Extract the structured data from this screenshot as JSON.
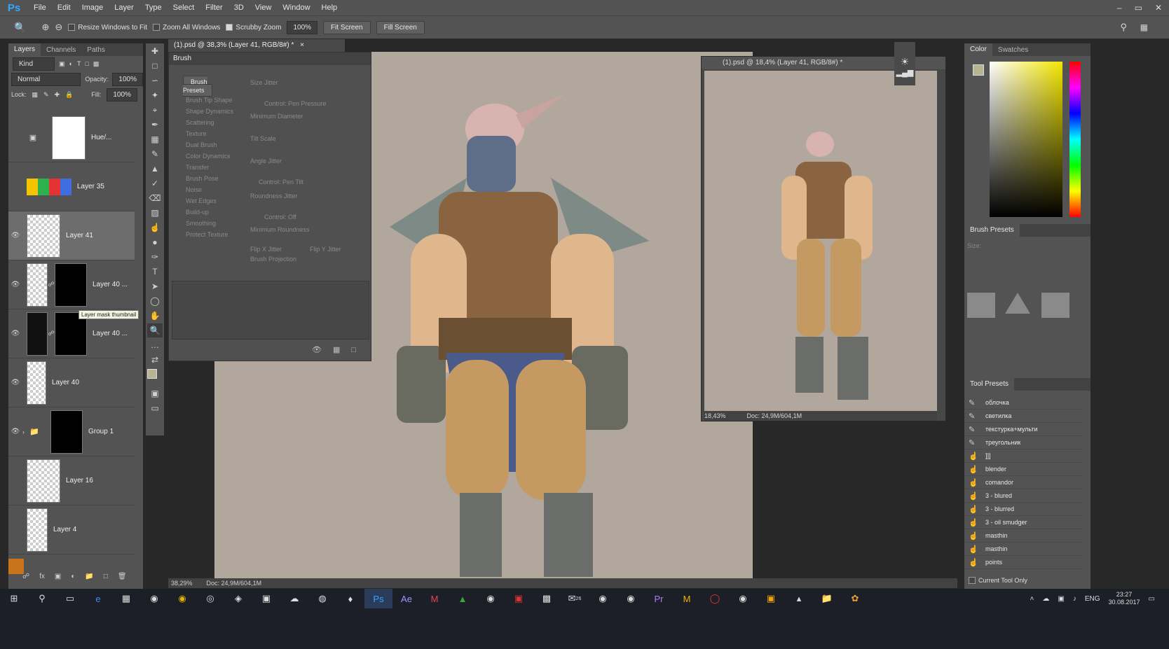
{
  "app": {
    "logo": "Ps"
  },
  "menu": [
    "File",
    "Edit",
    "Image",
    "Layer",
    "Type",
    "Select",
    "Filter",
    "3D",
    "View",
    "Window",
    "Help"
  ],
  "window_controls": {
    "minimize": "–",
    "restore": "▭",
    "close": "✕"
  },
  "options": {
    "resize_windows": "Resize Windows to Fit",
    "zoom_all": "Zoom All Windows",
    "scrubby_zoom": "Scrubby Zoom",
    "zoom_value": "100%",
    "fit_screen": "Fit Screen",
    "fill_screen": "Fill Screen"
  },
  "layers_panel": {
    "tabs": [
      "Layers",
      "Channels",
      "Paths"
    ],
    "kind": "Kind",
    "blend_mode": "Normal",
    "opacity_label": "Opacity:",
    "opacity_value": "100%",
    "lock_label": "Lock:",
    "fill_label": "Fill:",
    "fill_value": "100%",
    "layers": [
      {
        "name": "Hue/...",
        "visible": false
      },
      {
        "name": "Layer 35",
        "visible": false
      },
      {
        "name": "Layer 41",
        "visible": true,
        "selected": true
      },
      {
        "name": "Layer 40 ...",
        "visible": true
      },
      {
        "name": "Layer 40 ...",
        "visible": true
      },
      {
        "name": "Layer 40",
        "visible": true
      },
      {
        "name": "Group 1",
        "visible": true
      },
      {
        "name": "Layer 16",
        "visible": false
      },
      {
        "name": "Layer 4",
        "visible": false
      }
    ],
    "tooltip": "Layer mask thumbnail"
  },
  "document": {
    "tab_title": "(1).psd @ 38,3% (Layer 41, RGB/8#) *",
    "zoom": "38,29%",
    "doc_info": "Doc: 24,9M/604,1M"
  },
  "brush_panel": {
    "title": "Brush",
    "presets_button": "Brush Presets",
    "options": [
      "Brush Tip Shape",
      "Shape Dynamics",
      "Scattering",
      "Texture",
      "Dual Brush",
      "Color Dynamics",
      "Transfer",
      "Brush Pose",
      "Noise",
      "Wet Edges",
      "Build-up",
      "Smoothing",
      "Protect Texture"
    ],
    "settings": {
      "size_jitter": "Size Jitter",
      "control": "Control:",
      "pen_pressure": "Pen Pressure",
      "min_diameter": "Minimum Diameter",
      "tilt_scale": "Tilt Scale",
      "angle_jitter": "Angle Jitter",
      "pen_tilt": "Pen Tilt",
      "roundness_jitter": "Roundness Jitter",
      "off": "Off",
      "min_roundness": "Minimum Roundness",
      "flip_x": "Flip X Jitter",
      "flip_y": "Flip Y Jitter",
      "projection": "Brush Projection"
    }
  },
  "preview_window": {
    "title": "(1).psd @ 18,4% (Layer 41, RGB/8#) *",
    "zoom": "18,43%",
    "doc_info": "Doc: 24,9M/604,1M"
  },
  "right_panels": {
    "color_tabs": [
      "Color",
      "Swatches"
    ],
    "brush_presets_title": "Brush Presets",
    "size_label": "Size:",
    "tool_presets_title": "Tool Presets",
    "tool_presets": [
      "облочка",
      "светилка",
      "текстурка+мульти",
      "треугольник",
      "]]]",
      "blender",
      "comandor",
      "3 - blured",
      "3 - blurred",
      "3 - oil smudger",
      "masthin",
      "masthin",
      "points"
    ],
    "current_tool_only": "Current Tool Only"
  },
  "taskbar": {
    "language": "ENG",
    "time": "23:27",
    "date": "30.08.2017",
    "mail_badge": "26"
  },
  "colors": {
    "accent": "#31a8ff",
    "canvas_bg": "#b1a79c"
  }
}
